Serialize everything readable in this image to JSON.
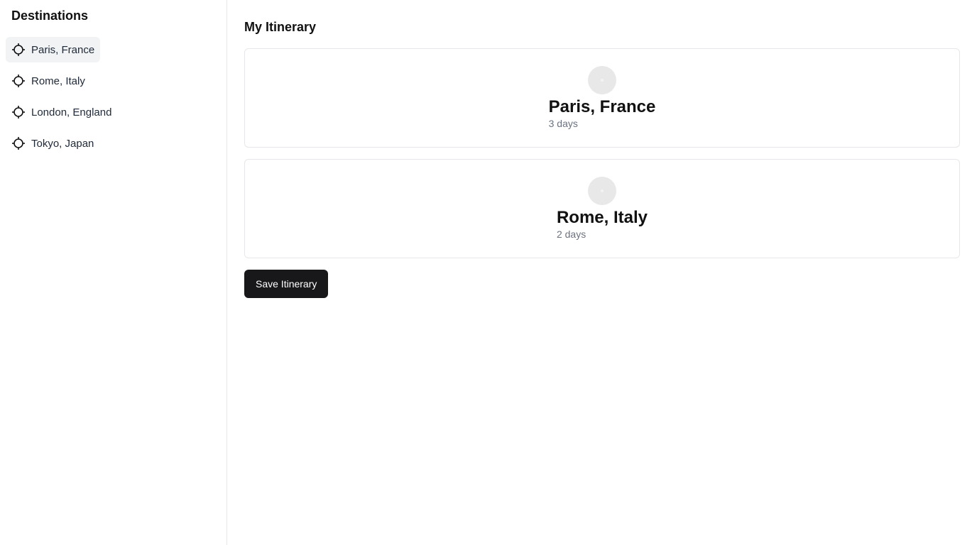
{
  "sidebar": {
    "title": "Destinations",
    "items": [
      {
        "label": "Paris, France",
        "icon": "crosshair-icon",
        "active": true
      },
      {
        "label": "Rome, Italy",
        "icon": "crosshair-icon",
        "active": false
      },
      {
        "label": "London, England",
        "icon": "crosshair-icon",
        "active": false
      },
      {
        "label": "Tokyo, Japan",
        "icon": "crosshair-icon",
        "active": false
      }
    ]
  },
  "main": {
    "title": "My Itinerary",
    "cards": [
      {
        "title": "Paris, France",
        "duration": "3 days",
        "image": "destination-image-placeholder"
      },
      {
        "title": "Rome, Italy",
        "duration": "2 days",
        "image": "destination-image-placeholder"
      }
    ],
    "save_label": "Save Itinerary"
  },
  "colors": {
    "accent": "#18181b",
    "active_bg": "#f1f3f5",
    "border": "#e5e7eb",
    "muted_text": "#6b7280"
  }
}
